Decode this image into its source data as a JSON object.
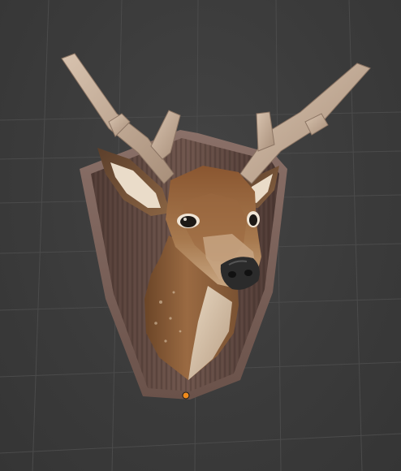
{
  "viewport": {
    "background_color": "#3d3d3d",
    "grid_color": "#4a4a4a",
    "origin_marker_color": "#f08a1c"
  },
  "object": {
    "type": "mounted deer head trophy",
    "plaque_color": "#6b524a",
    "fur_color": "#8a5a34",
    "antler_color": "#c9b09a",
    "nose_color": "#2a2a2a"
  }
}
